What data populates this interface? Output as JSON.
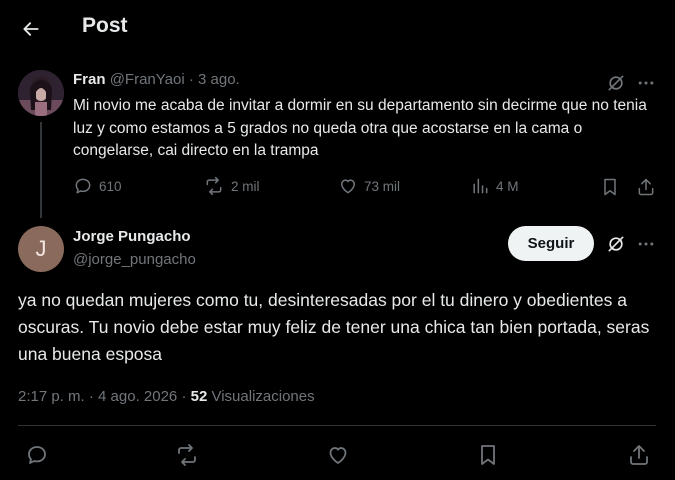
{
  "header": {
    "title": "Post",
    "back_icon": "arrow-left-icon"
  },
  "parent_post": {
    "author_name": "Fran",
    "handle": "@FranYaoi",
    "separator": " · ",
    "date": "3 ago.",
    "text": "Mi novio me acaba de invitar a dormir en su departamento sin decirme que no tenia luz y como estamos a 5 grados no queda otra que acostarse en la cama o congelarse, cai directo en la trampa",
    "stats": {
      "replies": "610",
      "reposts": "2 mil",
      "likes": "73 mil",
      "views": "4 M"
    }
  },
  "reply_post": {
    "author_name": "Jorge Pungacho",
    "handle": "@jorge_pungacho",
    "avatar_initial": "J",
    "follow_label": "Seguir",
    "text": "ya no quedan mujeres como tu, desinteresadas por el tu dinero y obedientes a oscuras. Tu novio debe estar muy feliz de tener una chica tan bien portada, seras una buena esposa",
    "time": "2:17 p. m. · 4 ago. 2026",
    "meta_sep": " · ",
    "views_count": "52",
    "views_label": "Visualizaciones"
  },
  "colors": {
    "background": "#000000",
    "text": "#e7e9ea",
    "muted": "#71767b",
    "divider": "#2f3336",
    "follow_bg": "#eff3f4"
  }
}
